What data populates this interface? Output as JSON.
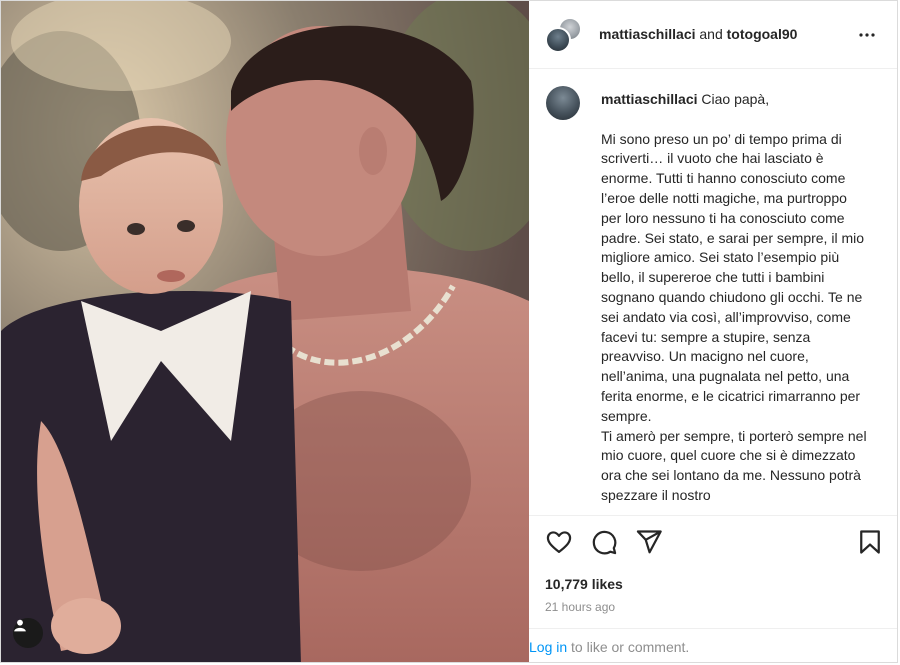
{
  "post": {
    "image_alt": "",
    "tag_icon": "user-tag-icon"
  },
  "header": {
    "author": "mattiaschillaci",
    "connector": " and ",
    "collaborator": "totogoal90",
    "more_icon": "more-horizontal-icon"
  },
  "caption": {
    "username": "mattiaschillaci",
    "text": " Ciao papà,\n\nMi sono preso un po’ di tempo prima di scriverti… il vuoto che hai lasciato è enorme. Tutti ti hanno conosciuto come l’eroe delle notti magiche, ma purtroppo per loro nessuno ti ha conosciuto come padre. Sei stato, e sarai per sempre, il mio migliore amico. Sei stato l’esempio più bello, il supereroe che tutti i bambini sognano quando chiudono gli occhi. Te ne sei andato via così, all’improvviso, come facevi tu: sempre a stupire, senza preavviso. Un macigno nel cuore, nell’anima, una pugnalata nel petto, una ferita enorme, e le cicatrici rimarranno per sempre.\nTi amerò per sempre, ti porterò sempre nel mio cuore, quel cuore che si è dimezzato ora che sei lontano da me. Nessuno potrà spezzare il nostro"
  },
  "actions": {
    "like_icon": "heart-icon",
    "comment_icon": "comment-icon",
    "share_icon": "share-icon",
    "save_icon": "bookmark-icon"
  },
  "stats": {
    "likes": "10,779 likes",
    "time": "21 hours ago"
  },
  "login": {
    "link": "Log in",
    "rest": " to like or comment."
  }
}
